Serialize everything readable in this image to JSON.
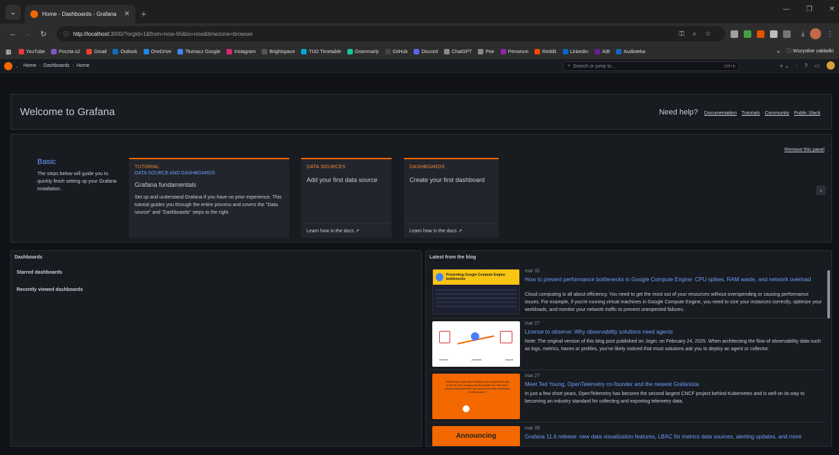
{
  "browser": {
    "tab_title": "Home - Dashboards - Grafana",
    "url_host": "http://localhost",
    "url_rest": ":3000/?orgId=1&from=now-6h&to=now&timezone=browser",
    "bookmarks": [
      {
        "label": "YouTube",
        "color": "#e53935"
      },
      {
        "label": "Poczta o2",
        "color": "#7e57c2"
      },
      {
        "label": "Gmail",
        "color": "#ea4335"
      },
      {
        "label": "Outlook",
        "color": "#0f6cbd"
      },
      {
        "label": "OneDrive",
        "color": "#1e88e5"
      },
      {
        "label": "Tłumacz Google",
        "color": "#4285f4"
      },
      {
        "label": "Instagram",
        "color": "#d62976"
      },
      {
        "label": "Brightspace",
        "color": "#555555"
      },
      {
        "label": "TUD Timetable",
        "color": "#00a6d6"
      },
      {
        "label": "Grammarly",
        "color": "#15c39a"
      },
      {
        "label": "GitHub",
        "color": "#444444"
      },
      {
        "label": "Discord",
        "color": "#5865f2"
      },
      {
        "label": "ChatGPT",
        "color": "#888888"
      },
      {
        "label": "Poe",
        "color": "#888888"
      },
      {
        "label": "Penseum",
        "color": "#8e24aa"
      },
      {
        "label": "Reddit",
        "color": "#ff4500"
      },
      {
        "label": "LinkedIn",
        "color": "#0a66c2"
      },
      {
        "label": "AIB",
        "color": "#6a1b9a"
      },
      {
        "label": "Audioteka",
        "color": "#1565c0"
      }
    ],
    "bookmarks_more": "»",
    "all_bookmarks": "Wszystkie zakładki"
  },
  "grafana": {
    "breadcrumbs": [
      "Home",
      "Dashboards",
      "Home"
    ],
    "search_placeholder": "Search or jump to...",
    "search_shortcut": "ctrl+k"
  },
  "welcome": {
    "title": "Welcome to Grafana",
    "help_label": "Need help?",
    "links": [
      "Documentation",
      "Tutorials",
      "Community",
      "Public Slack"
    ]
  },
  "getting_started": {
    "remove_label": "Remove this panel",
    "basic_title": "Basic",
    "basic_text": "The steps below will guide you to quickly finish setting up your Grafana installation.",
    "tutorial": {
      "kind": "TUTORIAL",
      "subtitle": "DATA SOURCE AND DASHBOARDS",
      "title": "Grafana fundamentals",
      "text": "Set up and understand Grafana if you have no prior experience. This tutorial guides you through the entire process and covers the \"Data source\" and \"Dashboards\" steps to the right."
    },
    "datasources": {
      "kind": "DATA SOURCES",
      "title": "Add your first data source",
      "learn": "Learn how in the docs"
    },
    "dashboards": {
      "kind": "DASHBOARDS",
      "title": "Create your first dashboard",
      "learn": "Learn how in the docs"
    }
  },
  "dashboards_panel": {
    "title": "Dashboards",
    "starred": "Starred dashboards",
    "recent": "Recently viewed dashboards"
  },
  "blog": {
    "title": "Latest from the blog",
    "posts": [
      {
        "date": "mar 31",
        "title": "How to prevent performance bottlenecks in Google Compute Engine: CPU spikes, RAM waste, and network overload",
        "body": "Cloud computing is all about efficiency. You need to get the most out of your resources without overspending or causing performance issues. For example, if you're running virtual machines in Google Compute Engine, you need to size your instances correctly, optimize your workloads, and monitor your network traffic to prevent unexpected failures.",
        "thumb_text": "Preventing Google Compute Engine bottlenecks"
      },
      {
        "date": "mar 27",
        "title": "License to observe: Why observability solutions need agents",
        "body": "Note: The original version of this blog post published on ;login: on February 24, 2025. When architecting the flow of observability data such as logs, metrics, traces or profiles, you've likely noticed that most solutions ask you to deploy an agent or collector.",
        "thumb_labels": [
          "receive",
          "process",
          "export"
        ]
      },
      {
        "date": "mar 27",
        "title": "Meet Ted Young, OpenTelemetry co-founder and the newest Grafanista",
        "body": "In just a few short years, OpenTelemetry has become the second largest CNCF project behind Kubernetes and is well on its way to becoming an industry standard for collecting and exporting telemetry data.",
        "thumb_text": "\"What's truly unique about Grafana is we can go all the way to the top of the company and find people who have direct personal experience with open source and really understand it in their bones.\""
      },
      {
        "date": "mar 26",
        "title": "Grafana 11.6 release: new data visualization features, LBAC for metrics data sources, alerting updates, and more",
        "body": "",
        "thumb_text": "Announcing"
      }
    ]
  }
}
